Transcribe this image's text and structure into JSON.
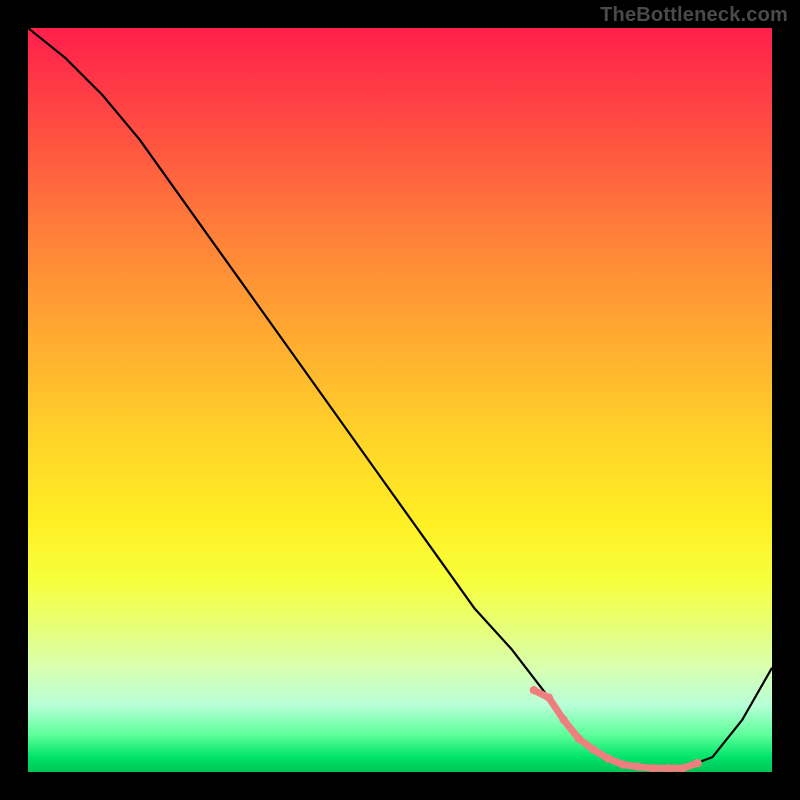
{
  "watermark": "TheBottleneck.com",
  "chart_data": {
    "type": "line",
    "title": "",
    "xlabel": "",
    "ylabel": "",
    "xlim": [
      0,
      100
    ],
    "ylim": [
      0,
      100
    ],
    "series": [
      {
        "name": "bottleneck-curve",
        "x": [
          0,
          5,
          10,
          15,
          20,
          25,
          30,
          35,
          40,
          45,
          50,
          55,
          60,
          65,
          70,
          73,
          76,
          80,
          84,
          88,
          92,
          96,
          100
        ],
        "values": [
          100,
          96,
          91,
          85,
          78,
          71,
          64,
          57,
          50,
          43,
          36,
          29,
          22,
          16.5,
          10,
          6,
          3,
          1,
          0.5,
          0.5,
          2,
          7,
          14
        ]
      },
      {
        "name": "highlight-segment",
        "x": [
          68,
          70,
          72,
          74,
          76,
          78,
          80,
          82,
          84,
          86,
          88,
          90
        ],
        "values": [
          11.0,
          10.0,
          7.0,
          4.5,
          3.0,
          1.8,
          1.0,
          0.7,
          0.5,
          0.5,
          0.5,
          1.2
        ]
      }
    ],
    "colors": {
      "curve": "#000000",
      "highlight": "#ef7f7f"
    },
    "gradient_stops": [
      {
        "pct": 0,
        "color": "#ff1f4b"
      },
      {
        "pct": 50,
        "color": "#ffd628"
      },
      {
        "pct": 95,
        "color": "#5dff9a"
      },
      {
        "pct": 100,
        "color": "#00c456"
      }
    ]
  }
}
